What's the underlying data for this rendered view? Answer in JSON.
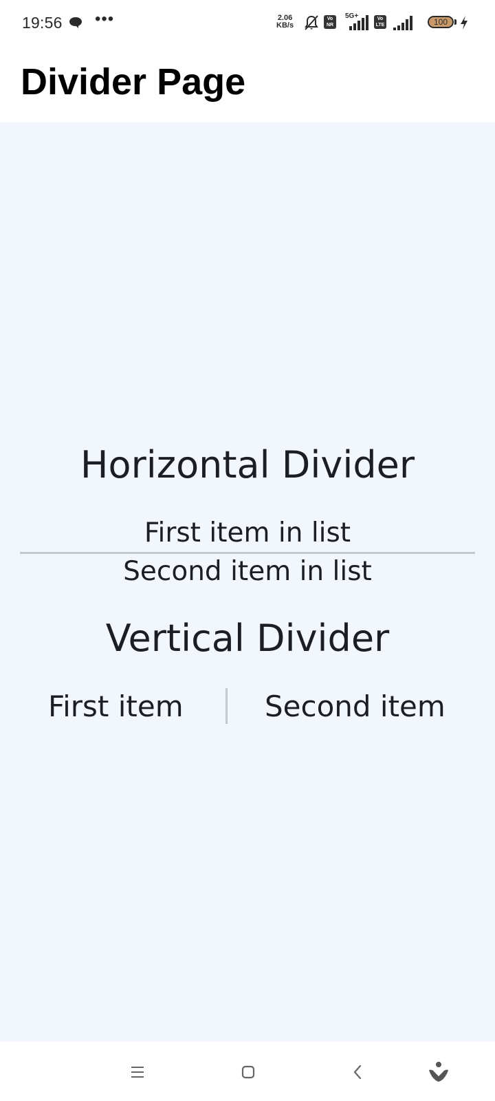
{
  "status_bar": {
    "time": "19:56",
    "more": "•••",
    "net_speed_value": "2.06",
    "net_speed_unit": "KB/s",
    "net_type": "5G+",
    "badge_nr": "Vo NR",
    "badge_lte": "Vo LTE",
    "battery": "100",
    "icons": [
      "chat-icon",
      "mute-icon",
      "signal-icon",
      "battery-icon",
      "charging-icon"
    ]
  },
  "app_bar": {
    "title": "Divider Page"
  },
  "horizontal": {
    "title": "Horizontal Divider",
    "item1": "First item in list",
    "item2": "Second item in list"
  },
  "vertical": {
    "title": "Vertical Divider",
    "item1": "First item",
    "item2": "Second item"
  },
  "nav_bar": {
    "icons": [
      "menu-icon",
      "home-icon",
      "back-icon",
      "assistant-icon"
    ]
  },
  "colors": {
    "content_background": "#f1f7fd",
    "divider": "#c3c8d2",
    "text": "#1b1f24"
  }
}
